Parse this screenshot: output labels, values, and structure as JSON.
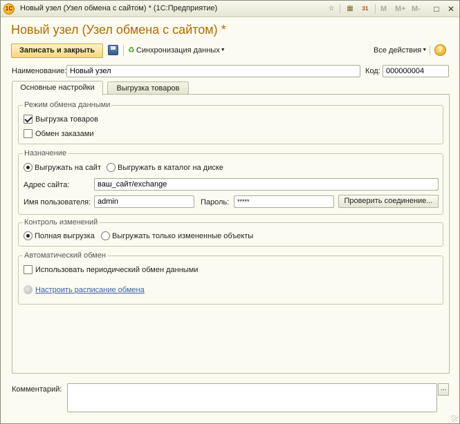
{
  "window": {
    "title": "Новый узел (Узел обмена с сайтом) *  (1С:Предприятие)",
    "toolbar_buttons": [
      "M",
      "M+",
      "M-"
    ]
  },
  "form": {
    "title": "Новый узел (Узел обмена с сайтом) *"
  },
  "commandbar": {
    "save_close_label": "Записать и закрыть",
    "sync_label": "Синхронизация данных",
    "all_actions_label": "Все действия",
    "help_label": "?"
  },
  "fields": {
    "name_label": "Наименование:",
    "name_value": "Новый узел",
    "code_label": "Код:",
    "code_value": "000000004"
  },
  "tabs": [
    {
      "label": "Основные настройки",
      "active": true
    },
    {
      "label": "Выгрузка товаров",
      "active": false
    }
  ],
  "exchange_mode": {
    "title": "Режим обмена данными",
    "options": [
      {
        "label": "Выгрузка товаров",
        "checked": true
      },
      {
        "label": "Обмен заказами",
        "checked": false
      }
    ]
  },
  "destination": {
    "title": "Назначение",
    "radio_site": "Выгружать на сайт",
    "radio_disk": "Выгружать в каталог на диске",
    "selected": "site",
    "site_address_label": "Адрес сайта:",
    "site_address_value": "ваш_сайт/exchange",
    "username_label": "Имя пользователя:",
    "username_value": "admin",
    "password_label": "Пароль:",
    "password_value": "*****",
    "check_connection_label": "Проверить соединение..."
  },
  "change_control": {
    "title": "Контроль изменений",
    "radio_full": "Полная выгрузка",
    "radio_changed": "Выгружать только измененные объекты",
    "selected": "full"
  },
  "auto_exchange": {
    "title": "Автоматический обмен",
    "periodic_label": "Использовать периодический обмен данными",
    "periodic_checked": false,
    "schedule_link": "Настроить расписание обмена"
  },
  "comment": {
    "label": "Комментарий:",
    "value": "",
    "dots_label": "..."
  },
  "colors": {
    "title_accent": "#b06c00",
    "primary_button": "#f5d77b",
    "link": "#3a5fa0"
  }
}
